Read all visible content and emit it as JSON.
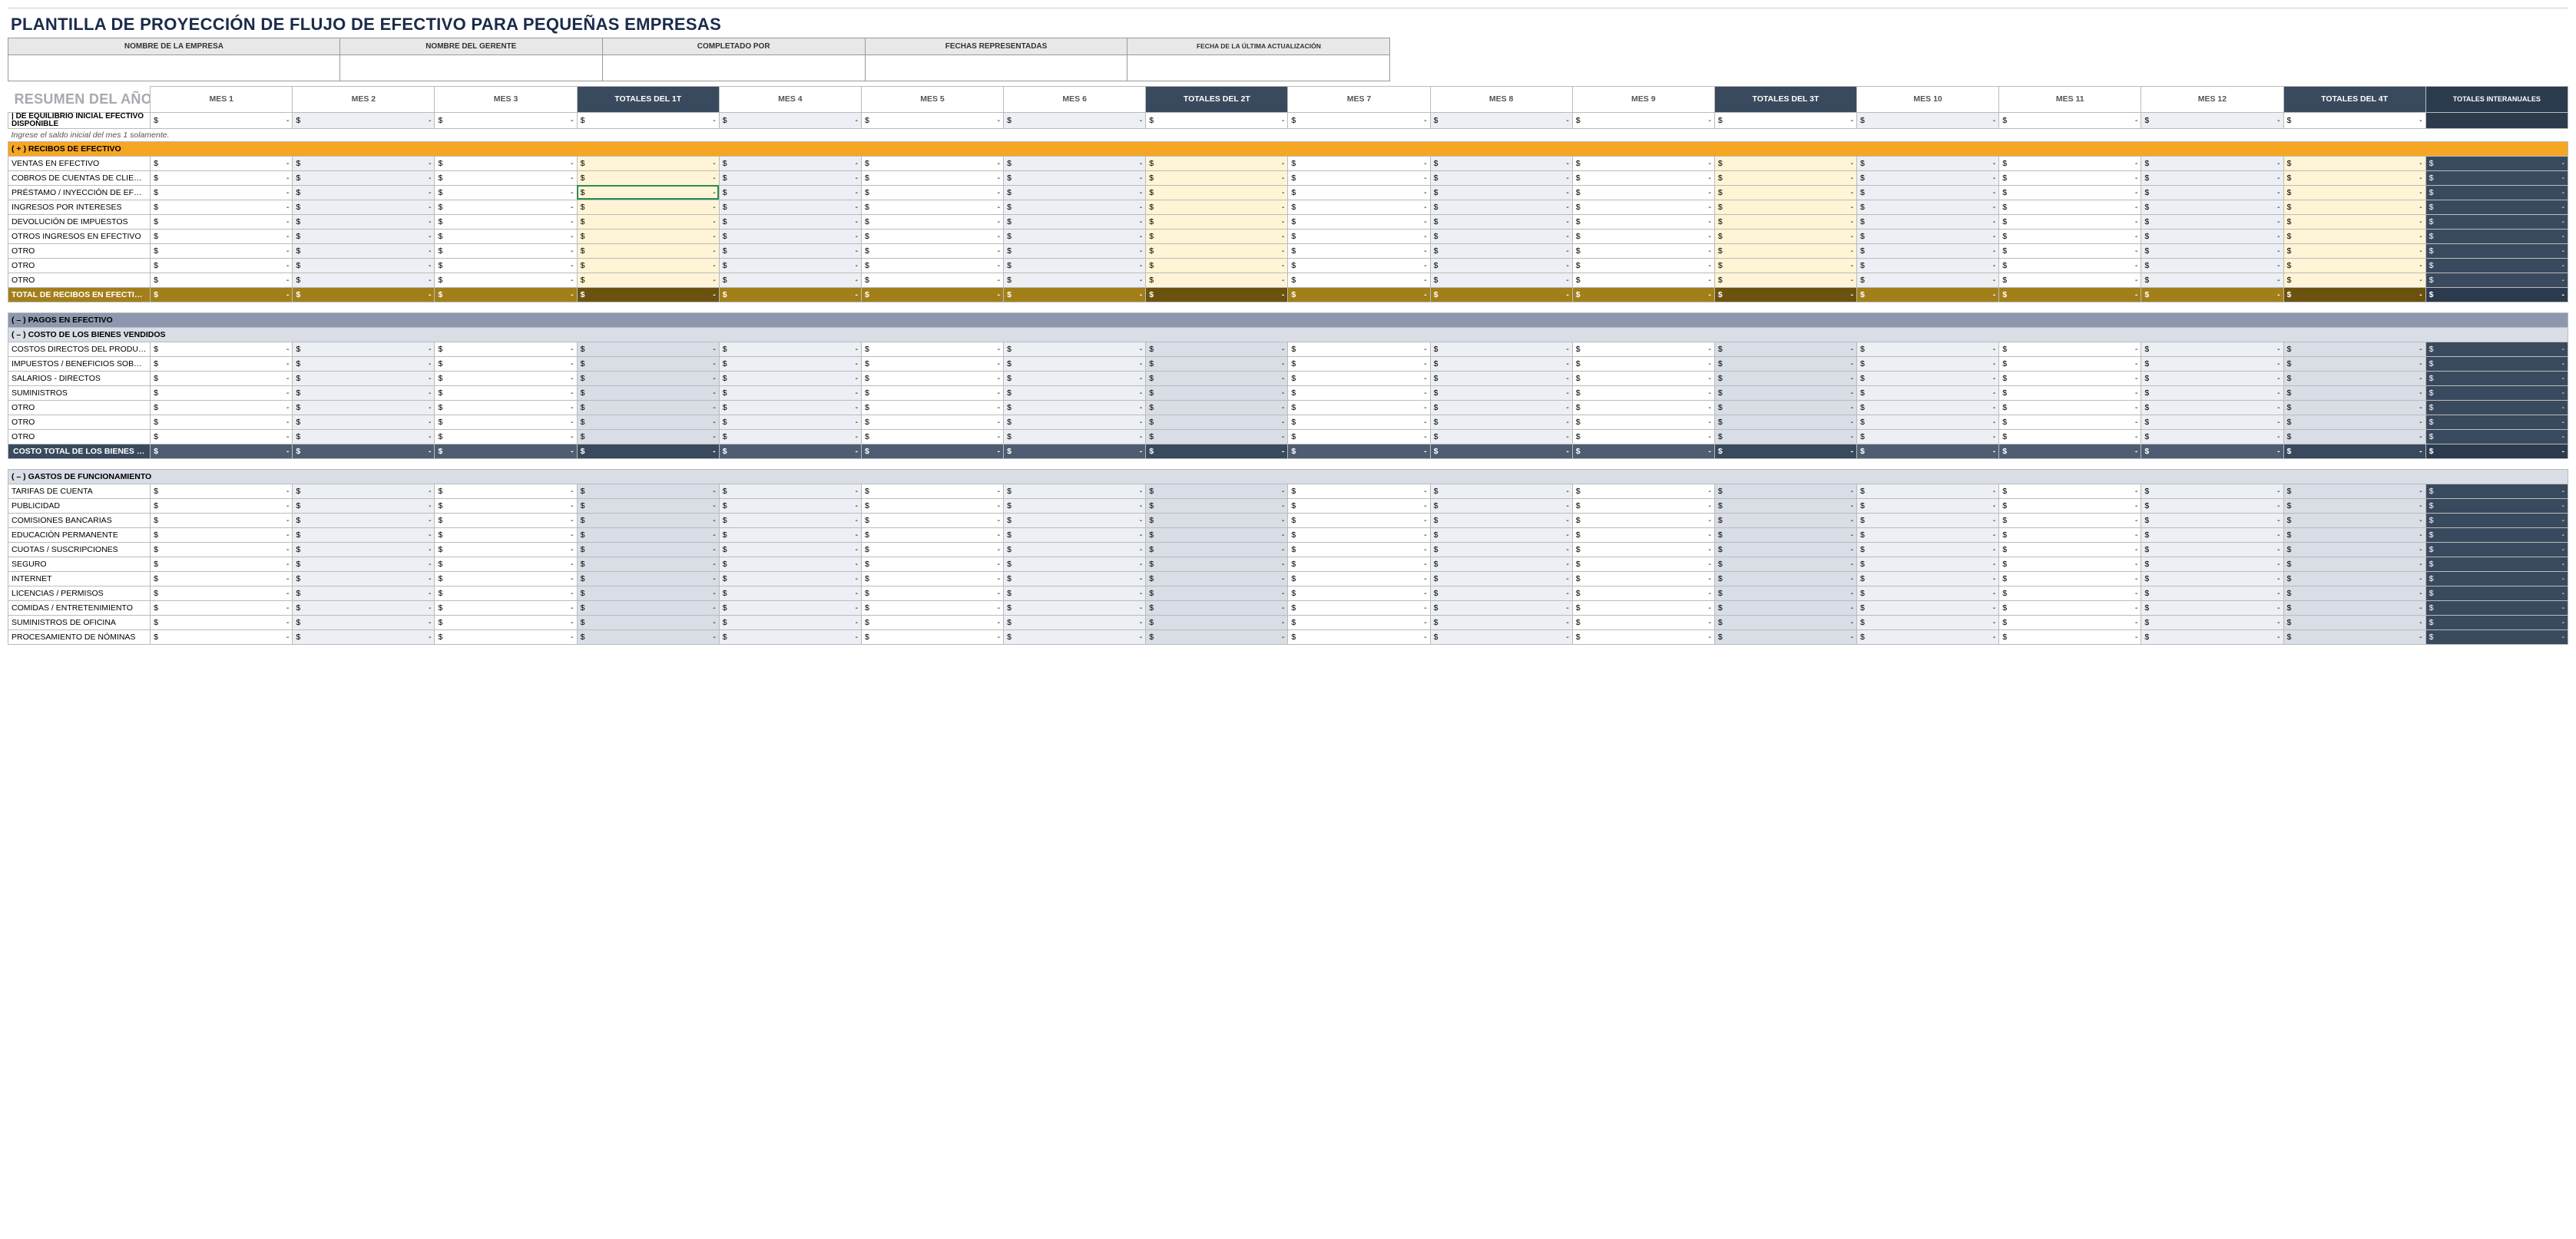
{
  "title": "PLANTILLA DE PROYECCIÓN DE FLUJO DE EFECTIVO PARA PEQUEÑAS EMPRESAS",
  "section_title": "RESUMEN DEL AÑO FISCAL",
  "info_headers": {
    "company": "NOMBRE DE LA EMPRESA",
    "manager": "NOMBRE DEL GERENTE",
    "completed_by": "COMPLETADO POR",
    "dates": "FECHAS REPRESENTADAS",
    "last_update": "FECHA DE LA ÚLTIMA ACTUALIZACIÓN"
  },
  "info_values": {
    "company": "",
    "manager": "",
    "completed_by": "",
    "dates": "",
    "last_update": ""
  },
  "col_headers": {
    "m1": "MES 1",
    "m2": "MES 2",
    "m3": "MES 3",
    "q1": "TOTALES DEL 1T",
    "m4": "MES 4",
    "m5": "MES 5",
    "m6": "MES 6",
    "q2": "TOTALES DEL 2T",
    "m7": "MES 7",
    "m8": "MES 8",
    "m9": "MES 9",
    "q3": "TOTALES DEL 3T",
    "m10": "MES 10",
    "m11": "MES 11",
    "m12": "MES 12",
    "q4": "TOTALES DEL 4T",
    "ia": "TOTALES INTERANUALES"
  },
  "balance_row": {
    "label": "| DE EQUILIBRIO INICIAL EFECTIVO DISPONIBLE",
    "note": "Ingrese el saldo inicial del mes 1 solamente."
  },
  "sections": {
    "cash_receipts": {
      "header": "( + )  RECIBOS DE EFECTIVO",
      "rows": [
        "VENTAS EN EFECTIVO",
        "COBROS DE CUENTAS DE CLIENTES",
        "PRÉSTAMO / INYECCIÓN DE EFECTIVO",
        "INGRESOS POR INTERESES",
        "DEVOLUCIÓN DE IMPUESTOS",
        "OTROS INGRESOS EN EFECTIVO",
        "OTRO",
        "OTRO",
        "OTRO"
      ],
      "total_label": "TOTAL DE RECIBOS EN EFECTIVO"
    },
    "cash_payments": {
      "header": "( – )  PAGOS EN EFECTIVO"
    },
    "cogs": {
      "header": "( – )  COSTO DE LOS BIENES VENDIDOS",
      "rows": [
        "COSTOS DIRECTOS DEL PRODUCTO / SVC",
        "IMPUESTOS / BENEFICIOS SOBRE LA NÓMINA - DIRECTO",
        "SALARIOS - DIRECTOS",
        "SUMINISTROS",
        "OTRO",
        "OTRO",
        "OTRO"
      ],
      "total_label": "COSTO TOTAL DE LOS BIENES VENDIDOS"
    },
    "opex": {
      "header": "( – )  GASTOS DE FUNCIONAMIENTO",
      "rows": [
        "TARIFAS DE CUENTA",
        "PUBLICIDAD",
        "COMISIONES BANCARIAS",
        "EDUCACIÓN PERMANENTE",
        "CUOTAS / SUSCRIPCIONES",
        "SEGURO",
        "INTERNET",
        "LICENCIAS / PERMISOS",
        "COMIDAS / ENTRETENIMIENTO",
        "SUMINISTROS DE OFICINA",
        "PROCESAMIENTO DE NÓMINAS"
      ]
    }
  },
  "cell": {
    "symbol": "$",
    "dash": "-"
  }
}
